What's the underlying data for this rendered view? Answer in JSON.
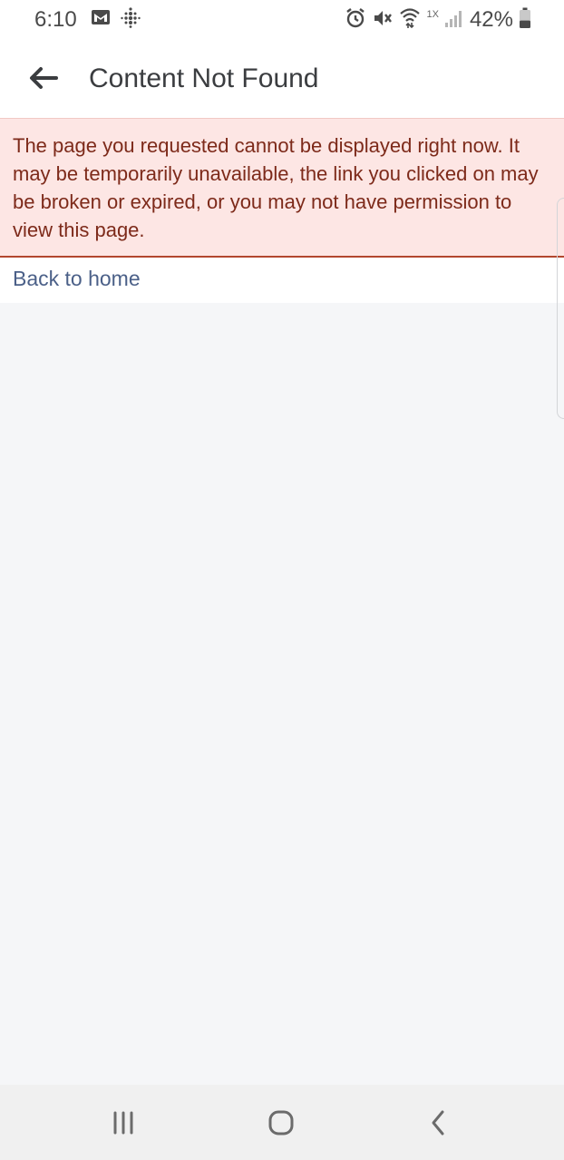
{
  "status_bar": {
    "time": "6:10",
    "left_icons": [
      "gmail-icon",
      "fitbit-icon"
    ],
    "right_icons": [
      "alarm-icon",
      "mute-icon",
      "wifi-icon",
      "signal-icon",
      "battery-icon"
    ],
    "network_label": "1X",
    "battery_percent": "42%",
    "battery_level": 0.42
  },
  "header": {
    "title": "Content Not Found",
    "back_icon": "back-arrow-icon"
  },
  "error": {
    "message": "The page you requested cannot be displayed right now. It may be temporarily unavailable, the link you clicked on may be broken or expired, or you may not have permission to view this page."
  },
  "home_link": {
    "label": "Back to home"
  },
  "nav_bar": {
    "icons": [
      "recent-apps-icon",
      "home-icon",
      "back-icon"
    ]
  },
  "colors": {
    "error_bg": "#fde6e4",
    "error_text": "#7d2a1a",
    "error_border": "#b2472e",
    "link": "#4b6088",
    "page_bg": "#f5f6f8"
  }
}
